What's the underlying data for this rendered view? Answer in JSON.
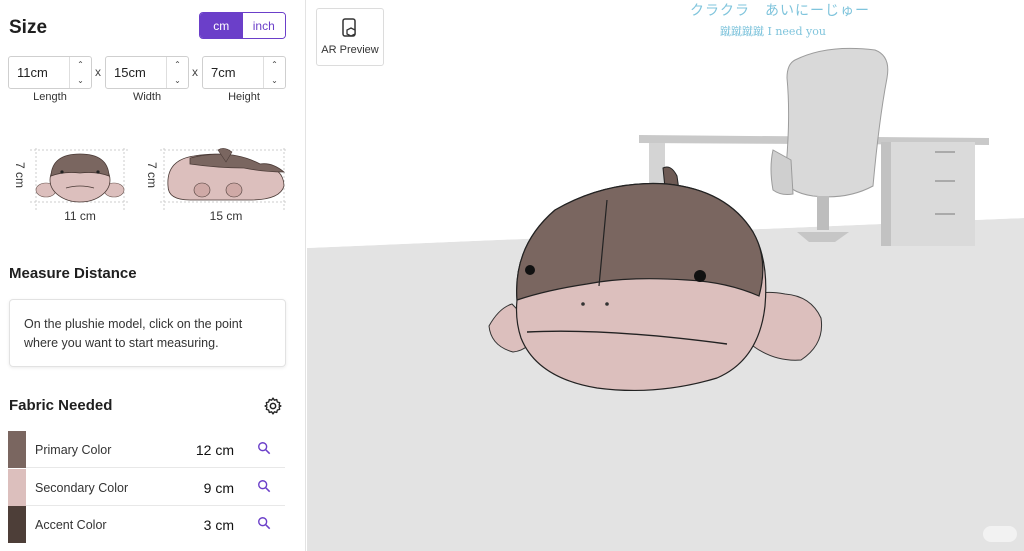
{
  "size": {
    "title": "Size",
    "units": [
      "cm",
      "inch"
    ],
    "active_unit": "cm",
    "length": {
      "value": "11cm",
      "label": "Length"
    },
    "width": {
      "value": "15cm",
      "label": "Width"
    },
    "height": {
      "value": "7cm",
      "label": "Height"
    },
    "separator": "x"
  },
  "thumbnails": [
    {
      "height_label": "7 cm",
      "width_label": "11 cm",
      "view": "front"
    },
    {
      "height_label": "7 cm",
      "width_label": "15 cm",
      "view": "side"
    }
  ],
  "measure": {
    "title": "Measure Distance",
    "instructions": "On the plushie model, click on the point where you want to start measuring."
  },
  "fabric": {
    "title": "Fabric Needed",
    "rows": [
      {
        "name": "Primary Color",
        "value": "12 cm",
        "color": "#7a6660"
      },
      {
        "name": "Secondary Color",
        "value": "9 cm",
        "color": "#dcbfbd"
      },
      {
        "name": "Accent Color",
        "value": "3 cm",
        "color": "#4d3e38"
      }
    ]
  },
  "viewport": {
    "ar_label": "AR Preview",
    "watermark_line1": "クラクラ　あいにーじゅー",
    "watermark_line2": "蹴蹴蹴蹴 I need you"
  },
  "colors": {
    "accent": "#6b3fc9",
    "plush_primary": "#7a6660",
    "plush_secondary": "#dcbfbd"
  }
}
